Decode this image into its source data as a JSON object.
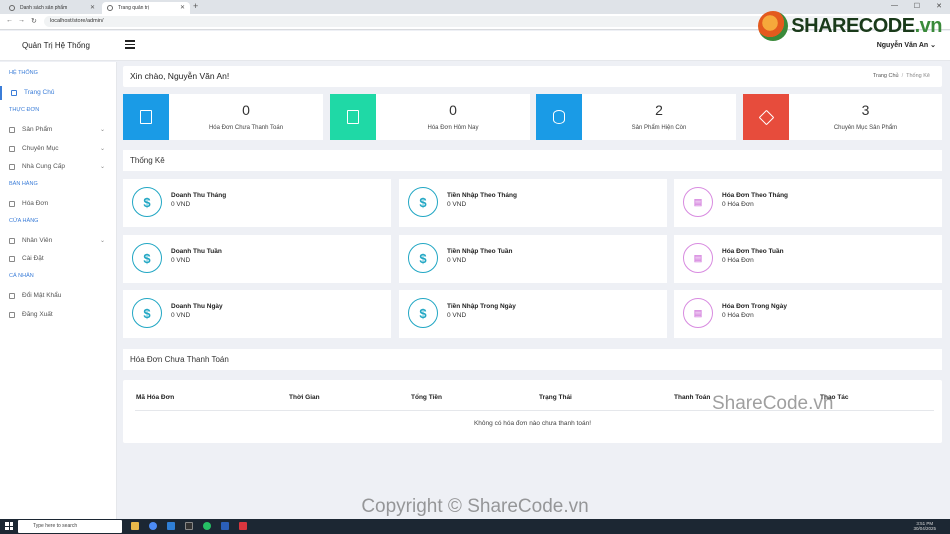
{
  "browser": {
    "tabs": [
      {
        "label": "Danh sách sản phẩm"
      },
      {
        "label": "Trang quản trị"
      }
    ],
    "url": "localhost/store/admin/"
  },
  "header": {
    "brand": "Quản Trị Hệ Thống",
    "user": "Nguyễn Văn An ⌄"
  },
  "sidebar": {
    "sections": [
      {
        "label": "HỆ THỐNG"
      },
      {
        "label": "THỰC ĐƠN"
      },
      {
        "label": "BÁN HÀNG"
      },
      {
        "label": "CỬA HÀNG"
      },
      {
        "label": "CÁ NHÂN"
      }
    ],
    "items": [
      {
        "label": "Trang Chủ"
      },
      {
        "label": "Sản Phẩm"
      },
      {
        "label": "Chuyên Mục"
      },
      {
        "label": "Nhà Cung Cấp"
      },
      {
        "label": "Hóa Đơn"
      },
      {
        "label": "Nhân Viên"
      },
      {
        "label": "Cài Đặt"
      },
      {
        "label": "Đổi Mật Khẩu"
      },
      {
        "label": "Đăng Xuất"
      }
    ]
  },
  "welcome": {
    "text": "Xin chào, Nguyễn Văn An!",
    "breadcrumb": {
      "home": "Trang Chủ",
      "current": "Thống Kê"
    }
  },
  "stats": [
    {
      "value": "0",
      "label": "Hóa Đơn Chưa Thanh Toán",
      "color": "#1a9be6"
    },
    {
      "value": "0",
      "label": "Hóa Đơn Hôm Nay",
      "color": "#1fd9a6"
    },
    {
      "value": "2",
      "label": "Sản Phẩm Hiện Còn",
      "color": "#1a9be6"
    },
    {
      "value": "3",
      "label": "Chuyên Mục Sản Phẩm",
      "color": "#e74c3c"
    }
  ],
  "section_title": "Thống Kê",
  "cards": [
    {
      "title": "Doanh Thu Tháng",
      "value": "0 VND",
      "icon": "dollar-icon"
    },
    {
      "title": "Tiền Nhập Theo Tháng",
      "value": "0 VND",
      "icon": "dollar-icon"
    },
    {
      "title": "Hóa Đơn Theo Tháng",
      "value": "0 Hóa Đơn",
      "icon": "invoice-icon"
    },
    {
      "title": "Doanh Thu Tuần",
      "value": "0 VND",
      "icon": "dollar-icon"
    },
    {
      "title": "Tiền Nhập Theo Tuần",
      "value": "0 VND",
      "icon": "dollar-icon"
    },
    {
      "title": "Hóa Đơn Theo Tuần",
      "value": "0 Hóa Đơn",
      "icon": "invoice-icon"
    },
    {
      "title": "Doanh Thu Ngày",
      "value": "0 VND",
      "icon": "dollar-icon"
    },
    {
      "title": "Tiền Nhập Trong Ngày",
      "value": "0 VND",
      "icon": "dollar-icon"
    },
    {
      "title": "Hóa Đơn Trong Ngày",
      "value": "0 Hóa Đơn",
      "icon": "invoice-icon"
    }
  ],
  "unpaid": {
    "title": "Hóa Đơn Chưa Thanh Toán",
    "columns": [
      "Mã Hóa Đơn",
      "Thời Gian",
      "Tổng Tiền",
      "Trạng Thái",
      "Thanh Toán",
      "Thao Tác"
    ],
    "empty": "Không có hóa đơn nào chưa thanh toán!"
  },
  "watermarks": {
    "logo": "SHARECODE",
    "logo_suffix": ".vn",
    "mid": "ShareCode.vn",
    "bottom": "Copyright © ShareCode.vn"
  },
  "taskbar": {
    "search_placeholder": "Type here to search",
    "time": "3:51 PM",
    "date": "30/04/2025"
  }
}
